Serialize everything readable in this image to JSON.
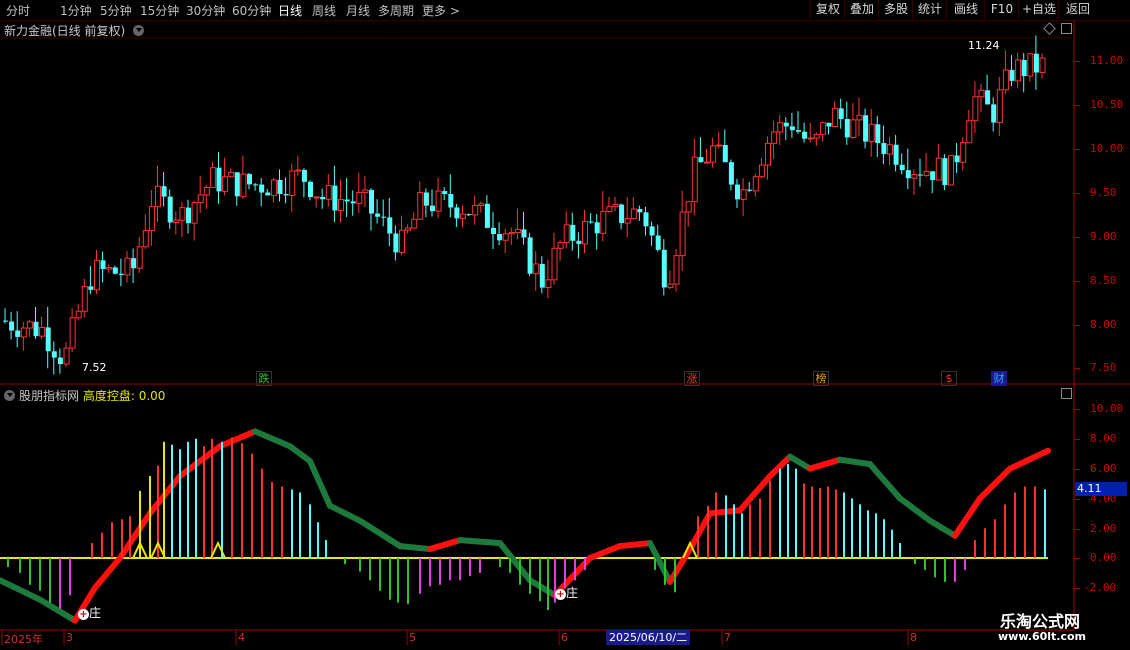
{
  "period_tabs": [
    {
      "label": "分时",
      "active": false
    },
    {
      "label": "1分钟",
      "active": false
    },
    {
      "label": "5分钟",
      "active": false
    },
    {
      "label": "15分钟",
      "active": false
    },
    {
      "label": "30分钟",
      "active": false
    },
    {
      "label": "60分钟",
      "active": false
    },
    {
      "label": "日线",
      "active": true
    },
    {
      "label": "周线",
      "active": false
    },
    {
      "label": "月线",
      "active": false
    },
    {
      "label": "多周期",
      "active": false
    },
    {
      "label": "更多 >",
      "active": false
    }
  ],
  "toolbar": [
    "复权",
    "叠加",
    "多股",
    "统计",
    "画线",
    "F10",
    "+自选",
    "返回"
  ],
  "main_title": "新力金融(日线 前复权)",
  "price_axis": [
    "11.00",
    "10.50",
    "10.00",
    "9.50",
    "9.00",
    "8.50",
    "8.00",
    "7.50"
  ],
  "high_label": "11.24",
  "low_label": "7.52",
  "signals": [
    {
      "text": "跌",
      "color": "#30c030"
    },
    {
      "text": "涨",
      "color": "#ff3030"
    },
    {
      "text": "榜",
      "color": "#e0a000"
    },
    {
      "text": "$",
      "color": "#ff3030"
    },
    {
      "text": "财",
      "color": "#30a0ff"
    }
  ],
  "indicator": {
    "name": "股朋指标网",
    "param_label": "高度控盘:",
    "param_value": "0.00"
  },
  "ind_axis": [
    "10.00",
    "8.00",
    "6.00",
    "4.00",
    "2.00",
    "0.00",
    "-2.00"
  ],
  "ind_tag": "4.11",
  "markers": [
    "庄",
    "庄"
  ],
  "x_labels": [
    "2025年",
    "3",
    "4",
    "5",
    "6",
    "7",
    "8"
  ],
  "x_cursor": "2025/06/10/二",
  "watermark": {
    "title": "乐淘公式网",
    "url": "www.60lt.com"
  },
  "colors": {
    "up": "#ff3232",
    "down": "#54ffff",
    "axis": "#c00000",
    "yellow": "#e8e800",
    "green": "#1e7a3c"
  }
}
